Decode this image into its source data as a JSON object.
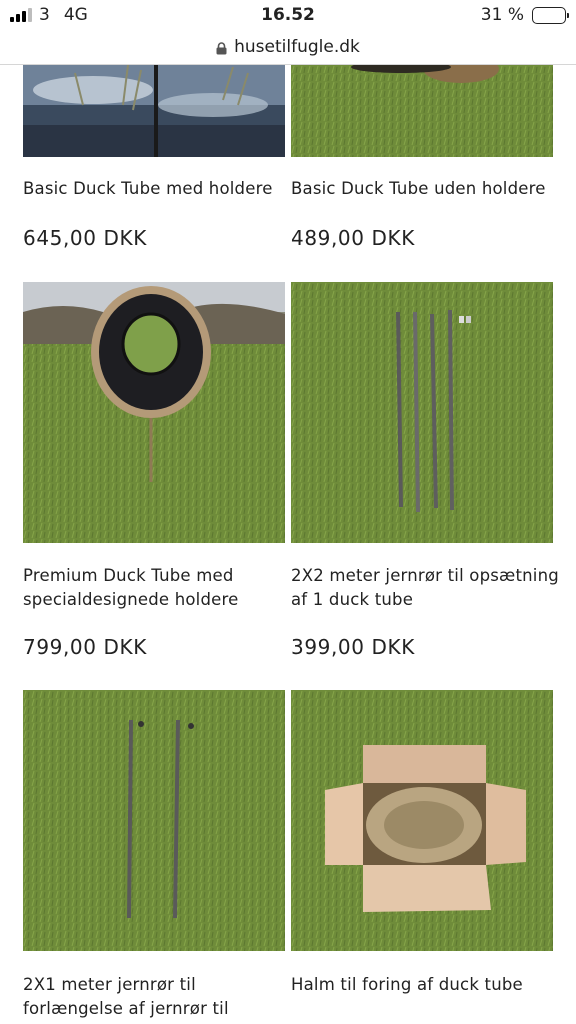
{
  "status_bar": {
    "carrier": "3",
    "network": "4G",
    "time": "16.52",
    "battery_text": "31 %",
    "battery_level": 0.31
  },
  "browser": {
    "url": "husetilfugle.dk"
  },
  "products": [
    {
      "name": "Basic Duck Tube med holdere",
      "price": "645,00 DKK",
      "image_icon": "pond-photo"
    },
    {
      "name": "Basic Duck Tube uden holdere",
      "price": "489,00 DKK",
      "image_icon": "grass-photo"
    },
    {
      "name": "Premium Duck Tube med specialdesignede holdere",
      "price": "799,00 DKK",
      "image_icon": "duck-tube-photo"
    },
    {
      "name": "2X2 meter jernrør til opsætning af 1 duck tube",
      "price": "399,00 DKK",
      "image_icon": "four-poles-photo"
    },
    {
      "name": "2X1 meter jernrør til forlængelse af jernrør til",
      "price": "",
      "image_icon": "two-poles-photo"
    },
    {
      "name": "Halm til foring af duck tube",
      "price": "",
      "image_icon": "straw-box-photo"
    }
  ],
  "colors": {
    "grass": "#6f8c3a",
    "text": "#222222",
    "url_divider": "#d6d6d6"
  }
}
